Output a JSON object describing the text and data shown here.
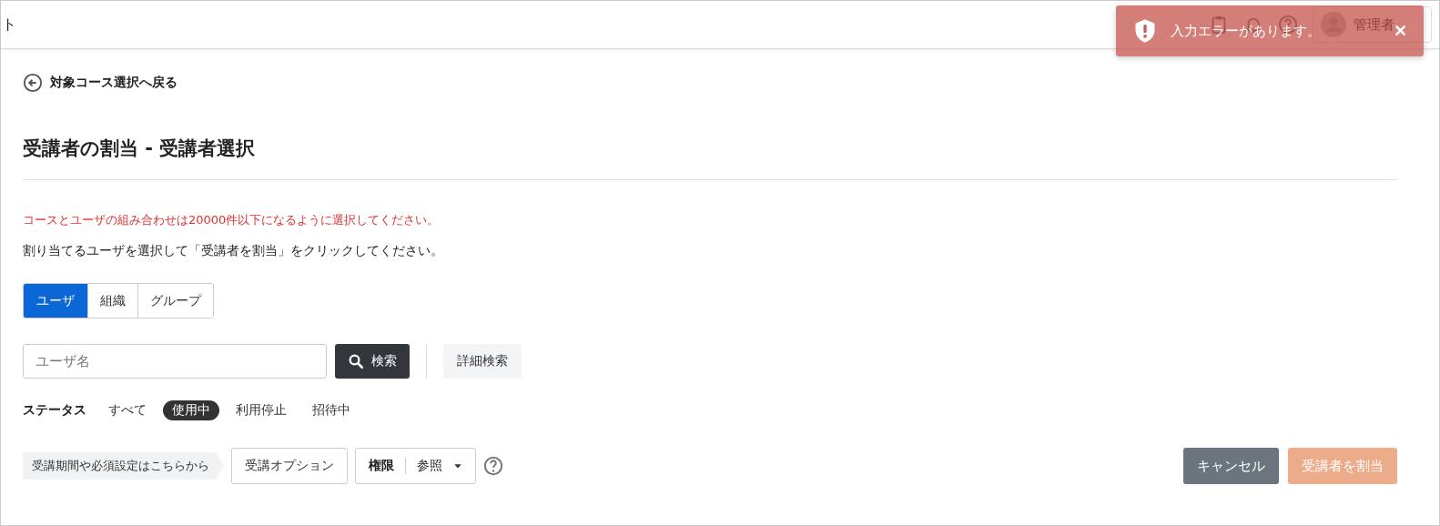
{
  "header": {
    "title": "ト",
    "user": "管理者"
  },
  "toast": {
    "message": "入力エラーがあります。",
    "close": "✕"
  },
  "back_link": "対象コース選択へ戻る",
  "page_title": "受講者の割当 - 受講者選択",
  "warning": "コースとユーザの組み合わせは20000件以下になるように選択してください。",
  "instruction": "割り当てるユーザを選択して「受講者を割当」をクリックしてください。",
  "tabs": [
    {
      "label": "ユーザ",
      "selected": true
    },
    {
      "label": "組織",
      "selected": false
    },
    {
      "label": "グループ",
      "selected": false
    }
  ],
  "search": {
    "placeholder": "ユーザ名",
    "button": "検索",
    "advanced": "詳細検索"
  },
  "status": {
    "label": "ステータス",
    "options": [
      {
        "label": "すべて",
        "selected": false
      },
      {
        "label": "使用中",
        "selected": true
      },
      {
        "label": "利用停止",
        "selected": false
      },
      {
        "label": "招待中",
        "selected": false
      }
    ]
  },
  "options_hint": "受講期間や必須設定はこちらから",
  "options_button": "受講オプション",
  "permission": {
    "label": "権限",
    "value": "参照"
  },
  "buttons": [
    {
      "label": "キャンセル",
      "kind": "cancel",
      "disabled": false
    },
    {
      "label": "受講者を割当",
      "kind": "primary",
      "disabled": true
    }
  ]
}
